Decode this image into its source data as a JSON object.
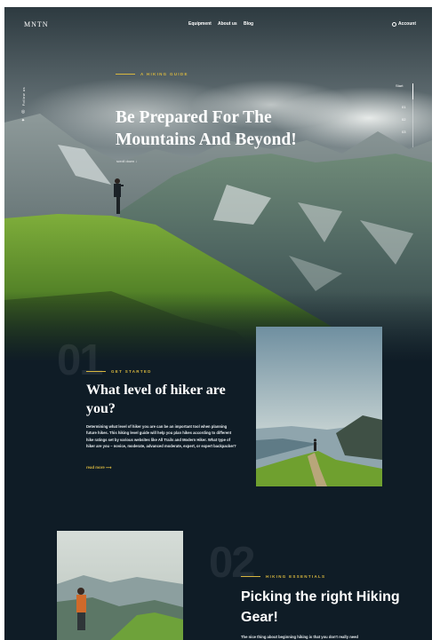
{
  "brand": {
    "logo": "MNTN"
  },
  "nav": {
    "equipment": "Equipment",
    "about": "About us",
    "blog": "Blog",
    "account": "Account"
  },
  "icons": {
    "account": "user-icon",
    "instagram": "instagram-icon",
    "twitter": "twitter-icon",
    "scroll": "arrow-down-icon",
    "more": "arrow-right-icon"
  },
  "hero": {
    "kicker": "A HIKING GUIDE",
    "title": "Be Prepared For The Mountains And Beyond!",
    "scroll_label": "scroll down",
    "social_label": "Follow us",
    "slides": {
      "label": "Start",
      "items": [
        "01",
        "02",
        "03"
      ]
    }
  },
  "section1": {
    "number": "01",
    "kicker": "GET STARTED",
    "title": "What level of hiker are you?",
    "body": "Determining what level of hiker you are can be an important tool when planning future hikes. This hiking level guide will help you plan hikes according to different hike ratings set by various websites like All Trails and Modern Hiker. What type of hiker are you – novice, moderate, advanced moderate, expert, or expert backpacker?",
    "more": "read more"
  },
  "section2": {
    "number": "02",
    "kicker": "HIKING ESSENTIALS",
    "title": "Picking the right Hiking Gear!",
    "body": "The nice thing about beginning hiking is that you don't really need"
  },
  "colors": {
    "background": "#0f1c26",
    "accent": "#d8b73f",
    "text": "#ffffff"
  }
}
